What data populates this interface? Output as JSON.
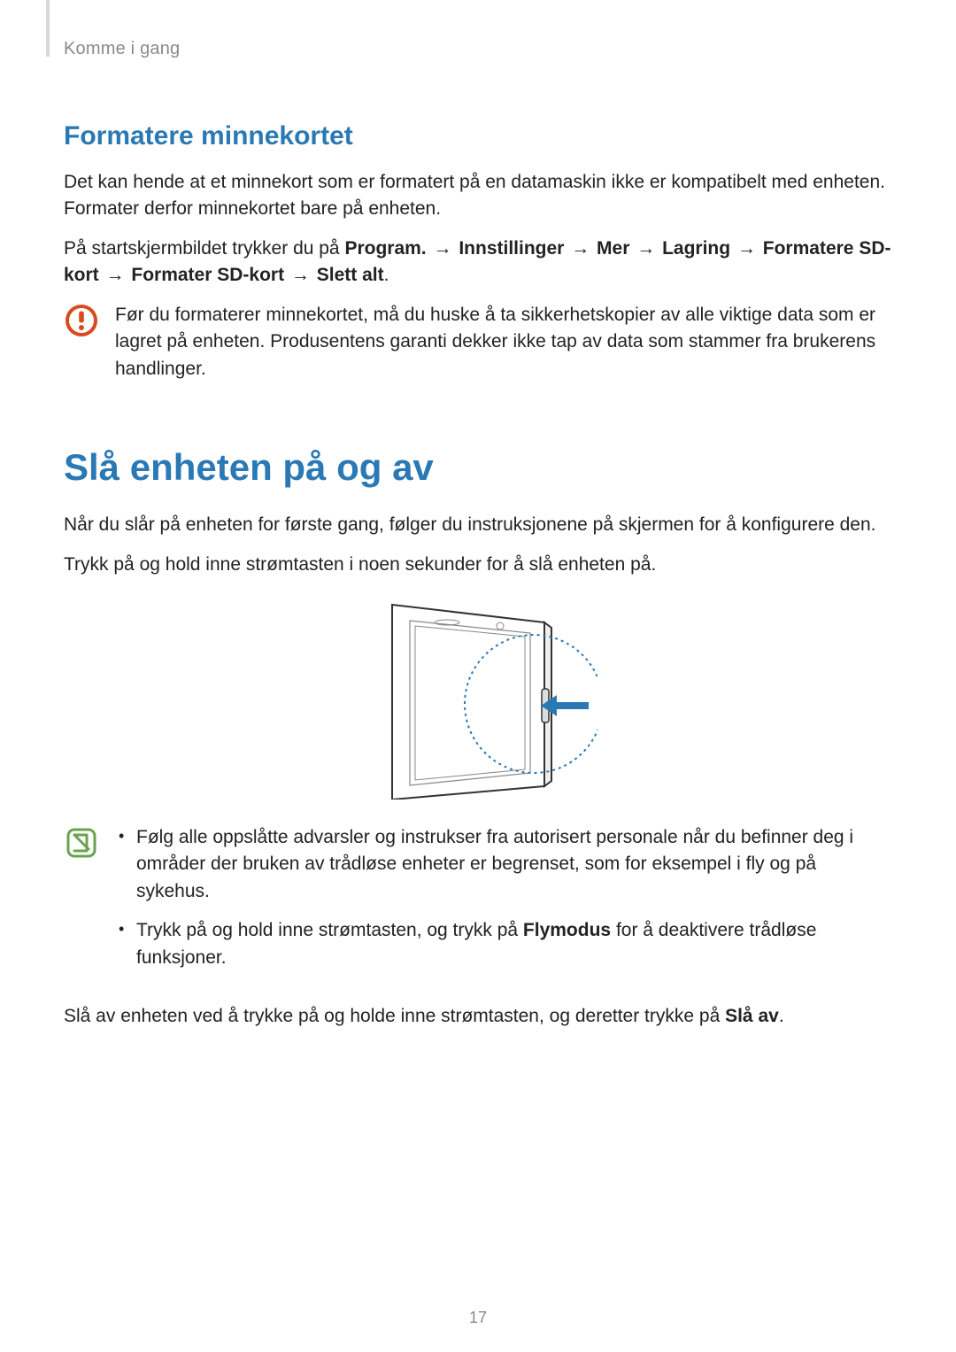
{
  "header": {
    "breadcrumb": "Komme i gang"
  },
  "section1": {
    "heading": "Formatere minnekortet",
    "para1": "Det kan hende at et minnekort som er formatert på en datamaskin ikke er kompatibelt med enheten. Formater derfor minnekortet bare på enheten.",
    "para2_prefix": "På startskjermbildet trykker du på ",
    "nav": {
      "program": "Program.",
      "innstillinger": "Innstillinger",
      "mer": "Mer",
      "lagring": "Lagring",
      "formatere_sd": "Formatere SD-kort",
      "formater_sd": "Formater SD-kort",
      "slett_alt": "Slett alt"
    },
    "arrow": "→",
    "period": ".",
    "warning": "Før du formaterer minnekortet, må du huske å ta sikkerhetskopier av alle viktige data som er lagret på enheten. Produsentens garanti dekker ikke tap av data som stammer fra brukerens handlinger."
  },
  "section2": {
    "heading": "Slå enheten på og av",
    "para1": "Når du slår på enheten for første gang, følger du instruksjonene på skjermen for å konfigurere den.",
    "para2": "Trykk på og hold inne strømtasten i noen sekunder for å slå enheten på.",
    "note1": "Følg alle oppslåtte advarsler og instrukser fra autorisert personale når du befinner deg i områder der bruken av trådløse enheter er begrenset, som for eksempel i fly og på sykehus.",
    "note2_prefix": "Trykk på og hold inne strømtasten, og trykk på ",
    "note2_bold": "Flymodus",
    "note2_suffix": " for å deaktivere trådløse funksjoner.",
    "para3_prefix": "Slå av enheten ved å trykke på og holde inne strømtasten, og deretter trykke på ",
    "para3_bold": "Slå av",
    "para3_suffix": "."
  },
  "footer": {
    "page_number": "17"
  },
  "colors": {
    "accent": "#2a79b5",
    "warning": "#d84a1f",
    "note": "#6aa34f"
  }
}
